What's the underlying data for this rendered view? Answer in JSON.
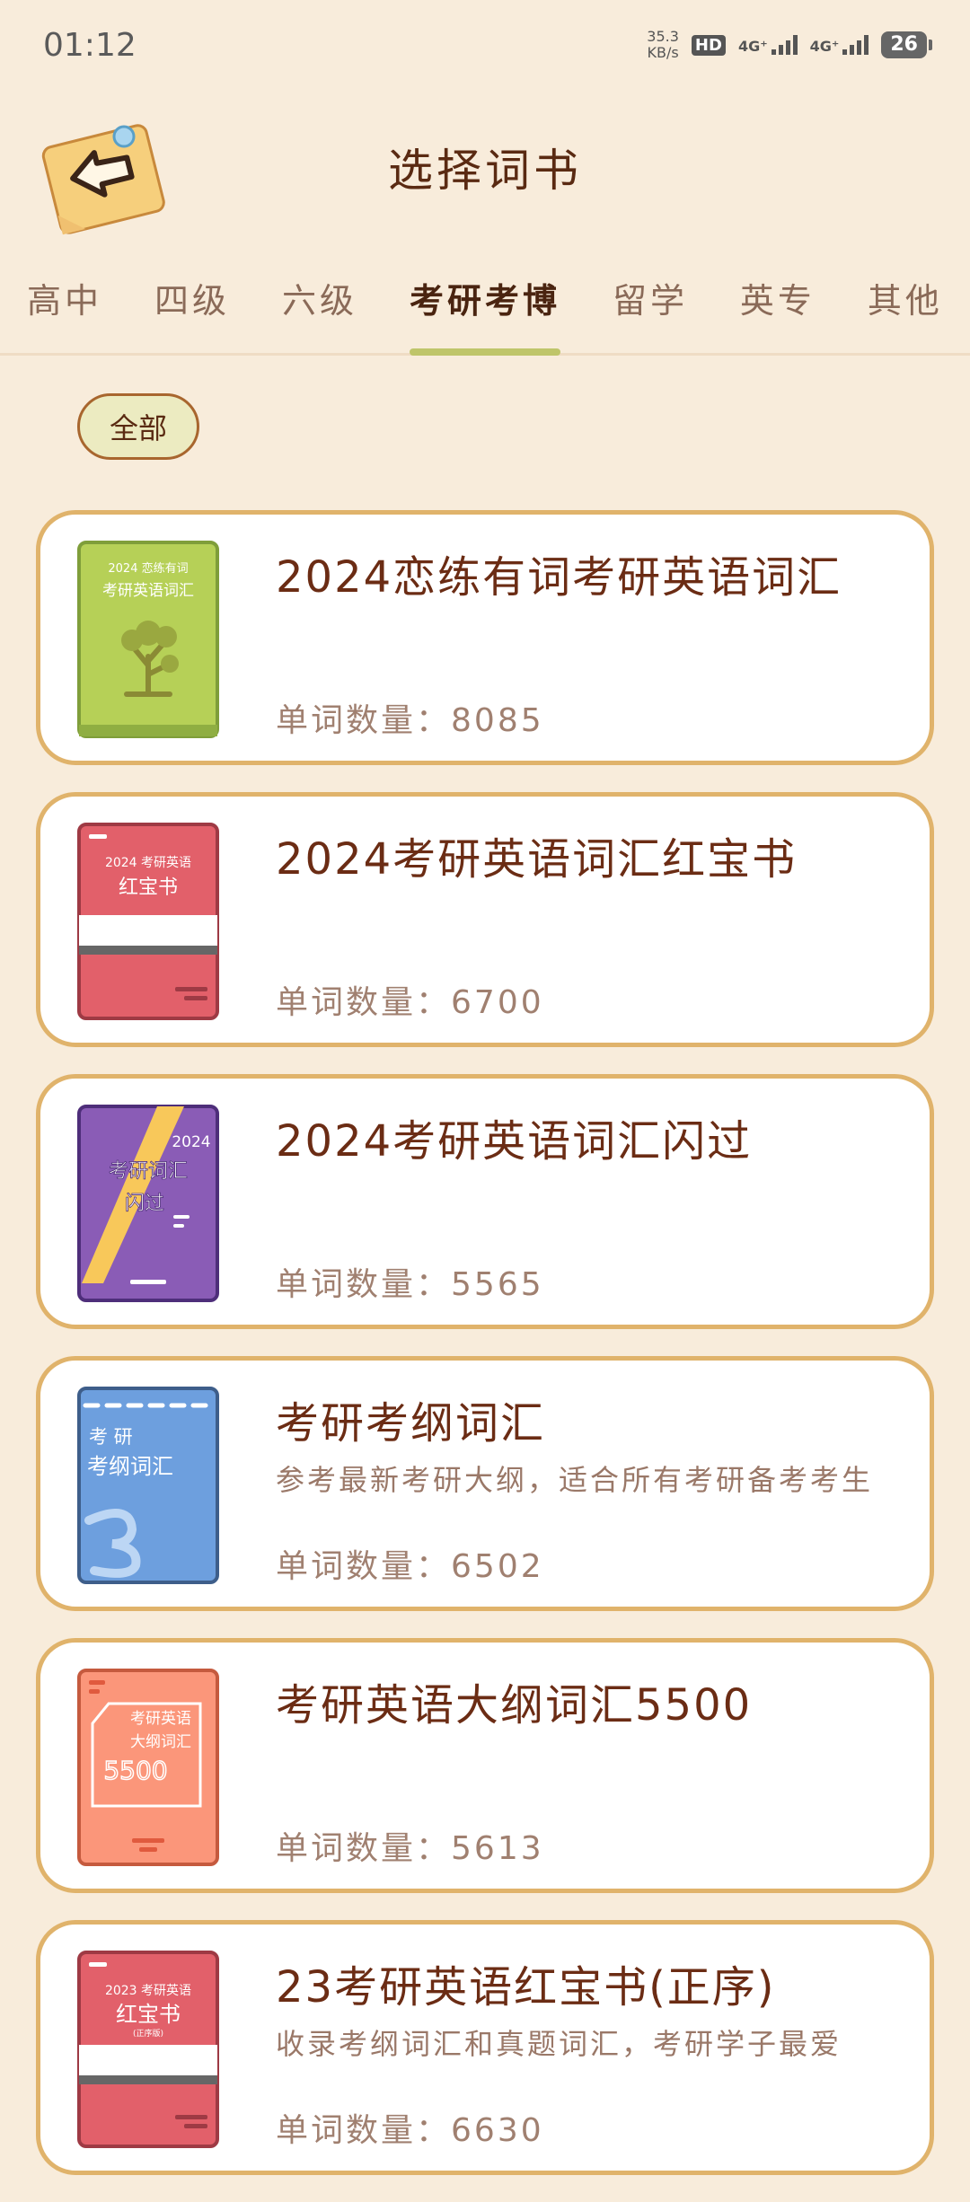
{
  "status": {
    "time": "01:12",
    "speed_value": "35.3",
    "speed_unit": "KB/s",
    "hd": "HD",
    "sim1": "4G⁺",
    "sim2": "4G⁺",
    "battery": "26"
  },
  "header": {
    "title": "选择词书",
    "back_icon": "back-arrow-note-icon"
  },
  "tabs": [
    {
      "label": "高中",
      "active": false
    },
    {
      "label": "四级",
      "active": false
    },
    {
      "label": "六级",
      "active": false
    },
    {
      "label": "考研考博",
      "active": true
    },
    {
      "label": "留学",
      "active": false
    },
    {
      "label": "英专",
      "active": false
    },
    {
      "label": "其他",
      "active": false
    }
  ],
  "filter": {
    "label": "全部"
  },
  "count_prefix": "单词数量：",
  "books": [
    {
      "title": "2024恋练有词考研英语词汇",
      "description": "",
      "count": "8085",
      "cover": {
        "year": "2024 恋练有词",
        "line1": "考研英语词汇",
        "color": "#b6d057"
      }
    },
    {
      "title": "2024考研英语词汇红宝书",
      "description": "",
      "count": "6700",
      "cover": {
        "year": "2024 考研英语",
        "line1": "红宝书",
        "color": "#e2606a"
      }
    },
    {
      "title": "2024考研英语词汇闪过",
      "description": "",
      "count": "5565",
      "cover": {
        "year": "2024",
        "line1": "考研词汇",
        "line2": "闪过",
        "color": "#8a5cb6"
      }
    },
    {
      "title": "考研考纲词汇",
      "description": "参考最新考研大纲，适合所有考研备考考生",
      "count": "6502",
      "cover": {
        "year": "考 研",
        "line1": "考纲词汇",
        "color": "#6d9fde"
      }
    },
    {
      "title": "考研英语大纲词汇5500",
      "description": "",
      "count": "5613",
      "cover": {
        "year": "考研英语",
        "line1": "大纲词汇",
        "line2": "5500",
        "color": "#fb967a"
      }
    },
    {
      "title": "23考研英语红宝书(正序)",
      "description": "收录考纲词汇和真题词汇，考研学子最爱",
      "count": "6630",
      "cover": {
        "year": "2023 考研英语",
        "line1": "红宝书",
        "line2": "(正序版)",
        "color": "#e2606a"
      }
    }
  ]
}
